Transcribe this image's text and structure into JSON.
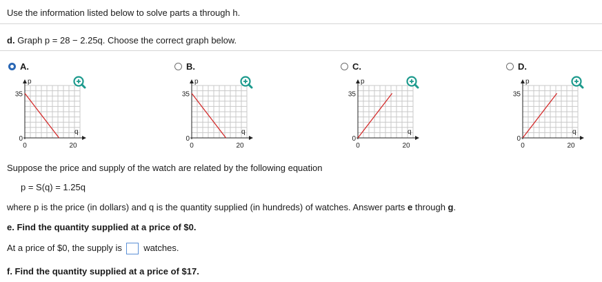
{
  "header": {
    "instruction": "Use the information listed below to solve parts a through h."
  },
  "part_d": {
    "prefix": "d.",
    "text": "Graph p = 28 − 2.25q. Choose the correct graph below."
  },
  "options": [
    {
      "letter": "A.",
      "selected": true,
      "line": "decreasing"
    },
    {
      "letter": "B.",
      "selected": false,
      "line": "decreasing"
    },
    {
      "letter": "C.",
      "selected": false,
      "line": "increasing"
    },
    {
      "letter": "D.",
      "selected": false,
      "line": "increasing"
    }
  ],
  "graph_labels": {
    "y_axis": "p",
    "x_axis": "q",
    "y_tick_top": "35",
    "y_tick_zero": "0",
    "x_tick_zero": "0",
    "x_tick_max": "20"
  },
  "zoom_icon": "zoom-in-icon",
  "colors": {
    "line": "#d42a2a",
    "accent": "#2a67b5",
    "zoom": "#1d9a8d",
    "grid": "#c8c8c8"
  },
  "intro": {
    "text": "Suppose the price and supply of the watch are related by the following equation"
  },
  "equation": {
    "text": "p = S(q) = 1.25q"
  },
  "where": {
    "text": "where p is the price (in dollars) and q is the quantity supplied (in hundreds) of watches. Answer parts ",
    "bold1": "e",
    "middle": " through ",
    "bold2": "g",
    "end": "."
  },
  "part_e": {
    "text": "e. Find the quantity supplied at a price of $0."
  },
  "answer_e": {
    "before": "At a price of $0, the supply is",
    "after": "watches.",
    "value": ""
  },
  "part_f": {
    "text": "f. Find the quantity supplied at a price of $17."
  }
}
